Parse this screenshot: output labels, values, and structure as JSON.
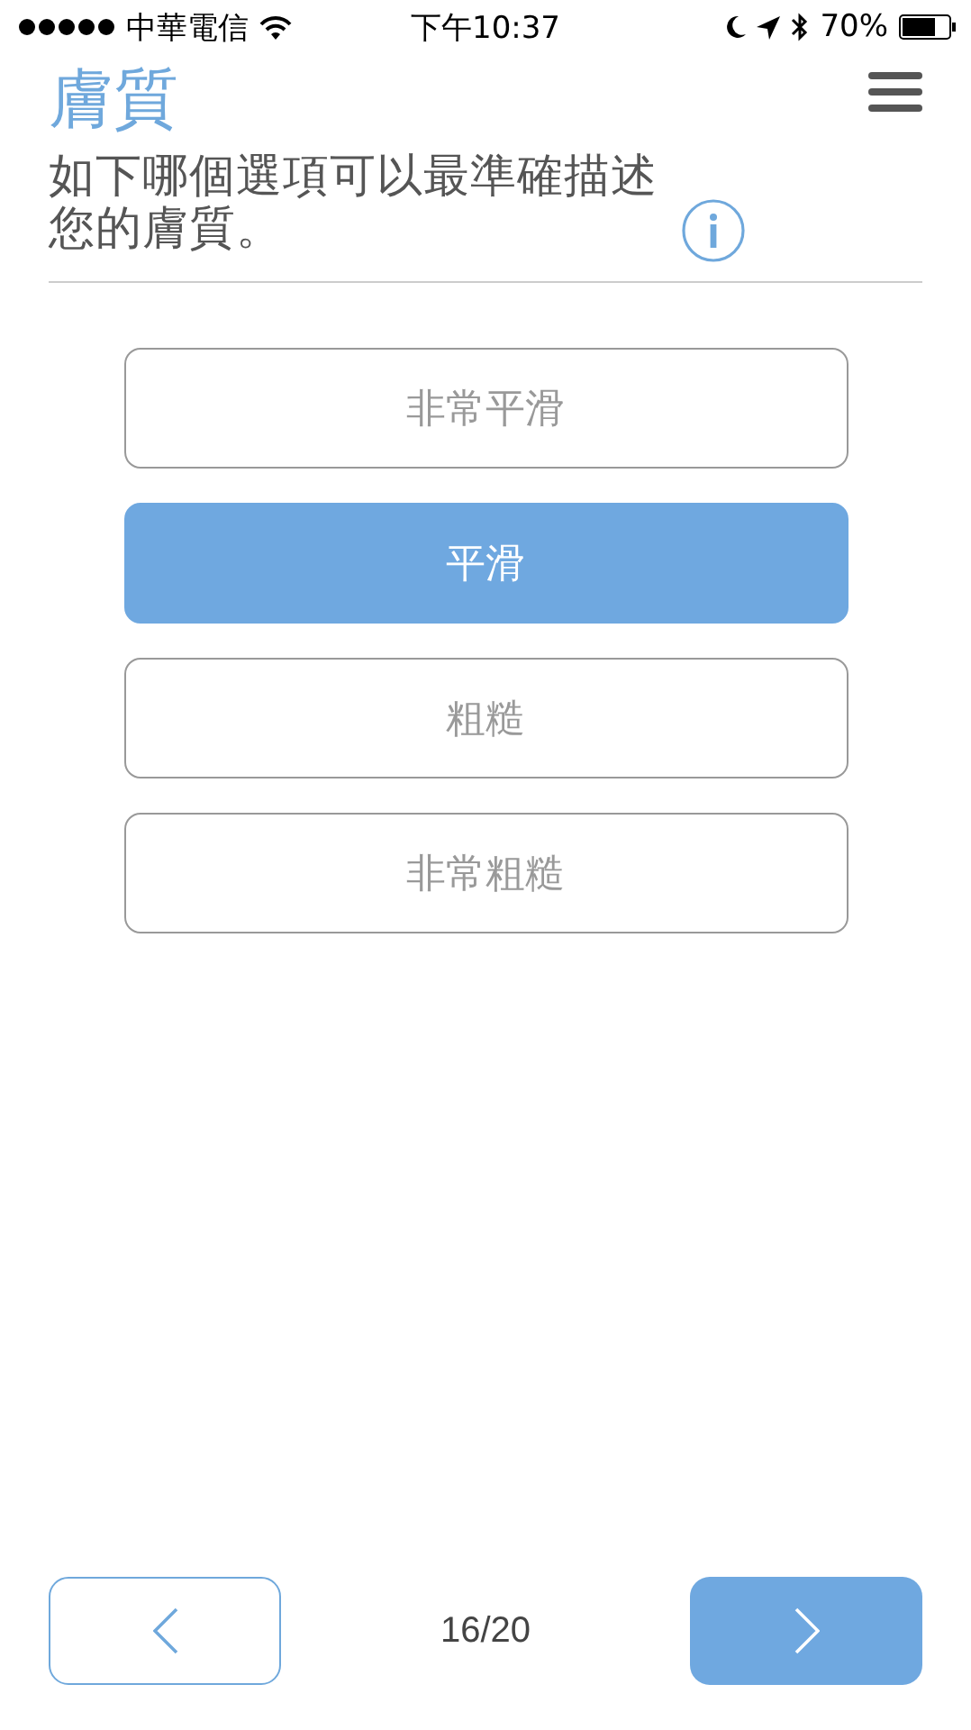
{
  "status_bar": {
    "carrier": "中華電信",
    "time": "下午10:37",
    "battery": "70%"
  },
  "title": "膚質",
  "question": "如下哪個選項可以最準確描述您的膚質。",
  "options": [
    {
      "label": "非常平滑",
      "selected": false
    },
    {
      "label": "平滑",
      "selected": true
    },
    {
      "label": "粗糙",
      "selected": false
    },
    {
      "label": "非常粗糙",
      "selected": false
    }
  ],
  "pager": "16/20"
}
